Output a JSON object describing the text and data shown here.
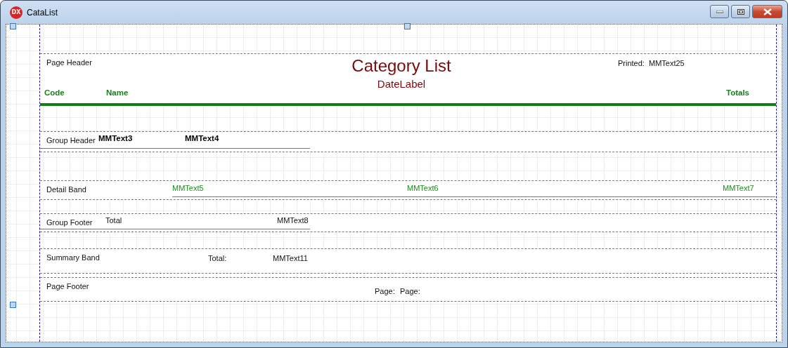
{
  "window": {
    "title": "CataList",
    "logo_text": "DX"
  },
  "bands": [
    {
      "kind": "page_header",
      "label": "Page Header",
      "items": [
        {
          "kind": "title",
          "text": "Category List"
        },
        {
          "kind": "subtitle",
          "text": "DateLabel"
        },
        {
          "kind": "plain",
          "text": "Printed:"
        },
        {
          "kind": "plain",
          "text": "MMText25"
        },
        {
          "kind": "column_head",
          "text": "Code"
        },
        {
          "kind": "column_head",
          "text": "Name"
        },
        {
          "kind": "column_head",
          "text": "Totals"
        }
      ]
    },
    {
      "kind": "group_header",
      "label": "Group Header",
      "items": [
        {
          "kind": "bold",
          "text": "MMText3"
        },
        {
          "kind": "bold",
          "text": "MMText4"
        }
      ]
    },
    {
      "kind": "detail",
      "label": "Detail Band",
      "items": [
        {
          "kind": "field",
          "text": "MMText5"
        },
        {
          "kind": "field",
          "text": "MMText6"
        },
        {
          "kind": "field",
          "text": "MMText7"
        }
      ]
    },
    {
      "kind": "group_footer",
      "label": "Group Footer",
      "items": [
        {
          "kind": "plain",
          "text": "Total"
        },
        {
          "kind": "plain",
          "text": "MMText8"
        }
      ]
    },
    {
      "kind": "summary",
      "label": "Summary Band",
      "items": [
        {
          "kind": "plain",
          "text": "Total:"
        },
        {
          "kind": "plain",
          "text": "MMText11"
        }
      ]
    },
    {
      "kind": "page_footer",
      "label": "Page Footer",
      "items": [
        {
          "kind": "plain",
          "text": "Page:"
        },
        {
          "kind": "plain",
          "text": "Page:"
        }
      ]
    }
  ]
}
